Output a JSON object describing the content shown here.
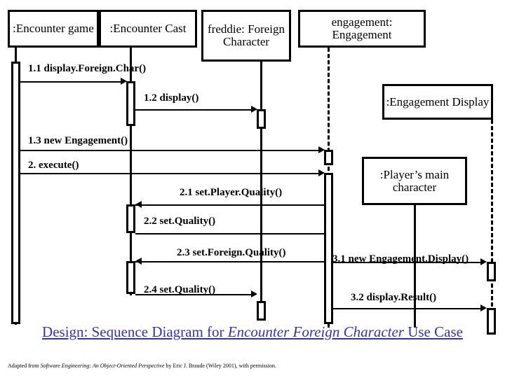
{
  "diagram": {
    "title_prefix": "Design: Sequence Diagram for ",
    "title_italic": "Encounter Foreign Character",
    "title_suffix": " Use Case",
    "title_color": "#3333aa",
    "footnote_prefix": "Adapted from ",
    "footnote_italic": "Software Engineering: An Object-Oriented Perspective",
    "footnote_suffix": " by Eric J. Braude (Wiley 2001), with permission."
  },
  "participants": [
    {
      "id": "encounter-game",
      "label": ":Encounter game"
    },
    {
      "id": "encounter-cast",
      "label": ":Encounter Cast"
    },
    {
      "id": "freddie",
      "label": "freddie: Foreign Character"
    },
    {
      "id": "engagement",
      "label": "engagement: Engagement"
    }
  ],
  "notes": [
    {
      "id": "engagement-display",
      "label": ":Engagement Display"
    },
    {
      "id": "players-main-character",
      "label": ":Player’s main character"
    }
  ],
  "messages": [
    {
      "num": "1.1",
      "label": "1.1 display.Foreign.Char()"
    },
    {
      "num": "1.2",
      "label": "1.2 display()"
    },
    {
      "num": "1.3",
      "label": "1.3 new Engagement()"
    },
    {
      "num": "2",
      "label": "2. execute()"
    },
    {
      "num": "2.1",
      "label": "2.1 set.Player.Quality()"
    },
    {
      "num": "2.2",
      "label": "2.2 set.Quality()"
    },
    {
      "num": "2.3",
      "label": "2.3 set.Foreign.Quality()"
    },
    {
      "num": "2.4",
      "label": "2.4 set.Quality()"
    },
    {
      "num": "3.1",
      "label": "3.1 new Engagement.Display()"
    },
    {
      "num": "3.2",
      "label": "3.2 display.Result()"
    }
  ]
}
